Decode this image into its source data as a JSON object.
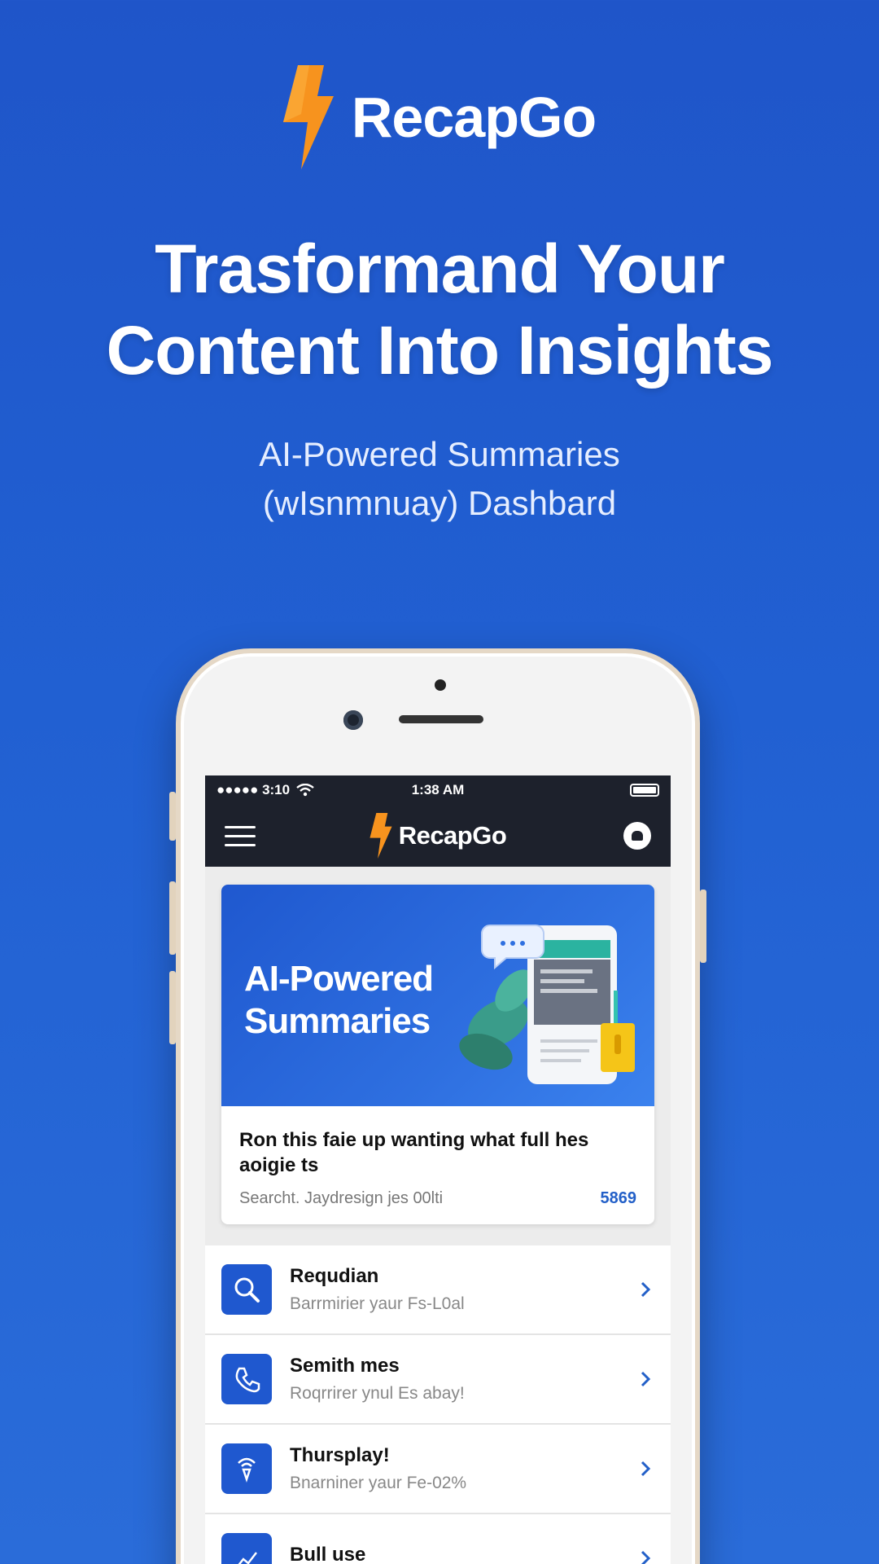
{
  "brand": {
    "name": "RecapGo"
  },
  "headline": {
    "line1": "Trasformand Your",
    "line2": "Content Into Insights"
  },
  "subline": {
    "line1": "AI-Powered Summaries",
    "line2": "(wIsnmnuay) Dashbard"
  },
  "phone": {
    "status": {
      "carrier": "●●●●● 3:10",
      "time": "1:38 AM"
    },
    "navbar": {
      "brand": "RecapGo"
    },
    "feature_card": {
      "hero_title": "AI-Powered Summaries",
      "headline": "Ron this faie up wanting what full hes aoigie ts",
      "subtitle": "Searcht. Jaydresign jes 00lti",
      "count": "5869"
    },
    "list": [
      {
        "title": "Requdian",
        "subtitle": "Barrmirier yaur Fs-L0al",
        "icon": "search-magnify-icon"
      },
      {
        "title": "Semith mes",
        "subtitle": "Roqrrirer ynul Es abay!",
        "icon": "phone-icon"
      },
      {
        "title": "Thursplay!",
        "subtitle": "Bnarniner yaur Fe-02%",
        "icon": "signal-icon"
      },
      {
        "title": "Bull use",
        "subtitle": "",
        "icon": "chart-icon"
      }
    ]
  },
  "colors": {
    "background": "#2160d2",
    "accent": "#f7931e",
    "dark": "#1d212c",
    "link": "#2360c8"
  }
}
